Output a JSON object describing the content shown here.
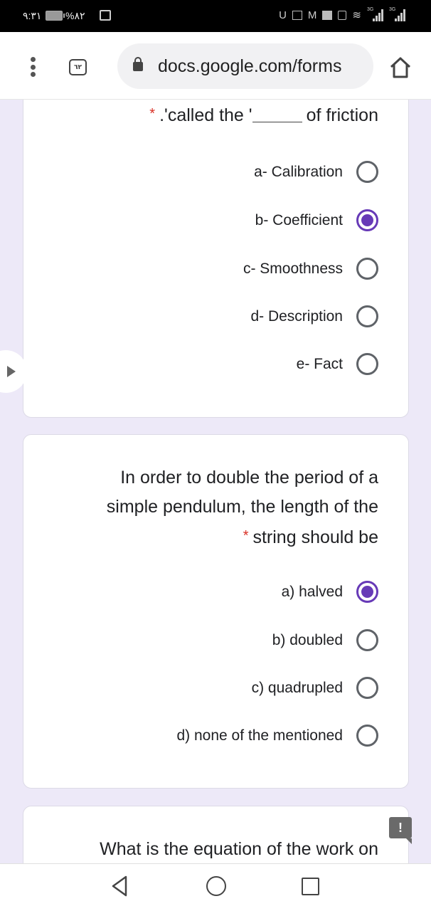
{
  "status_bar": {
    "time": "٩:٣١",
    "battery_percent": "%٨٢",
    "network_labels": [
      "3G",
      "3G"
    ],
    "icons": [
      "cast-icon",
      "u-icon",
      "gallery-icon",
      "gmail-icon",
      "mail-icon",
      "video-icon",
      "wifi-icon",
      "signal-icon",
      "signal-icon"
    ]
  },
  "browser": {
    "tab_count": "٦٢",
    "url": "docs.google.com/forms",
    "icons": [
      "menu-icon",
      "tabs-icon",
      "lock-icon",
      "home-icon"
    ]
  },
  "questions": [
    {
      "title": ".'called the '",
      "title_suffix": "of friction",
      "required_mark": "*",
      "options": [
        {
          "label": "a- Calibration",
          "checked": false
        },
        {
          "label": "b- Coefficient",
          "checked": true
        },
        {
          "label": "c- Smoothness",
          "checked": false
        },
        {
          "label": "d- Description",
          "checked": false
        },
        {
          "label": "e- Fact",
          "checked": false
        }
      ]
    },
    {
      "title_lines": [
        "In order to double the period of a",
        "simple pendulum, the length of the",
        "string should be"
      ],
      "required_mark": "*",
      "options": [
        {
          "label": "a) halved",
          "checked": true
        },
        {
          "label": "b) doubled",
          "checked": false
        },
        {
          "label": "c) quadrupled",
          "checked": false
        },
        {
          "label": "d) none of the mentioned",
          "checked": false
        }
      ]
    },
    {
      "title_lines": [
        "What is the equation of the work on"
      ]
    }
  ],
  "feedback_icon_glyph": "!",
  "colors": {
    "accent": "#673ab7",
    "required": "#d93025",
    "page_bg": "#ede9f8"
  },
  "nav_bar": {
    "buttons": [
      "back",
      "home",
      "recent-apps"
    ]
  }
}
